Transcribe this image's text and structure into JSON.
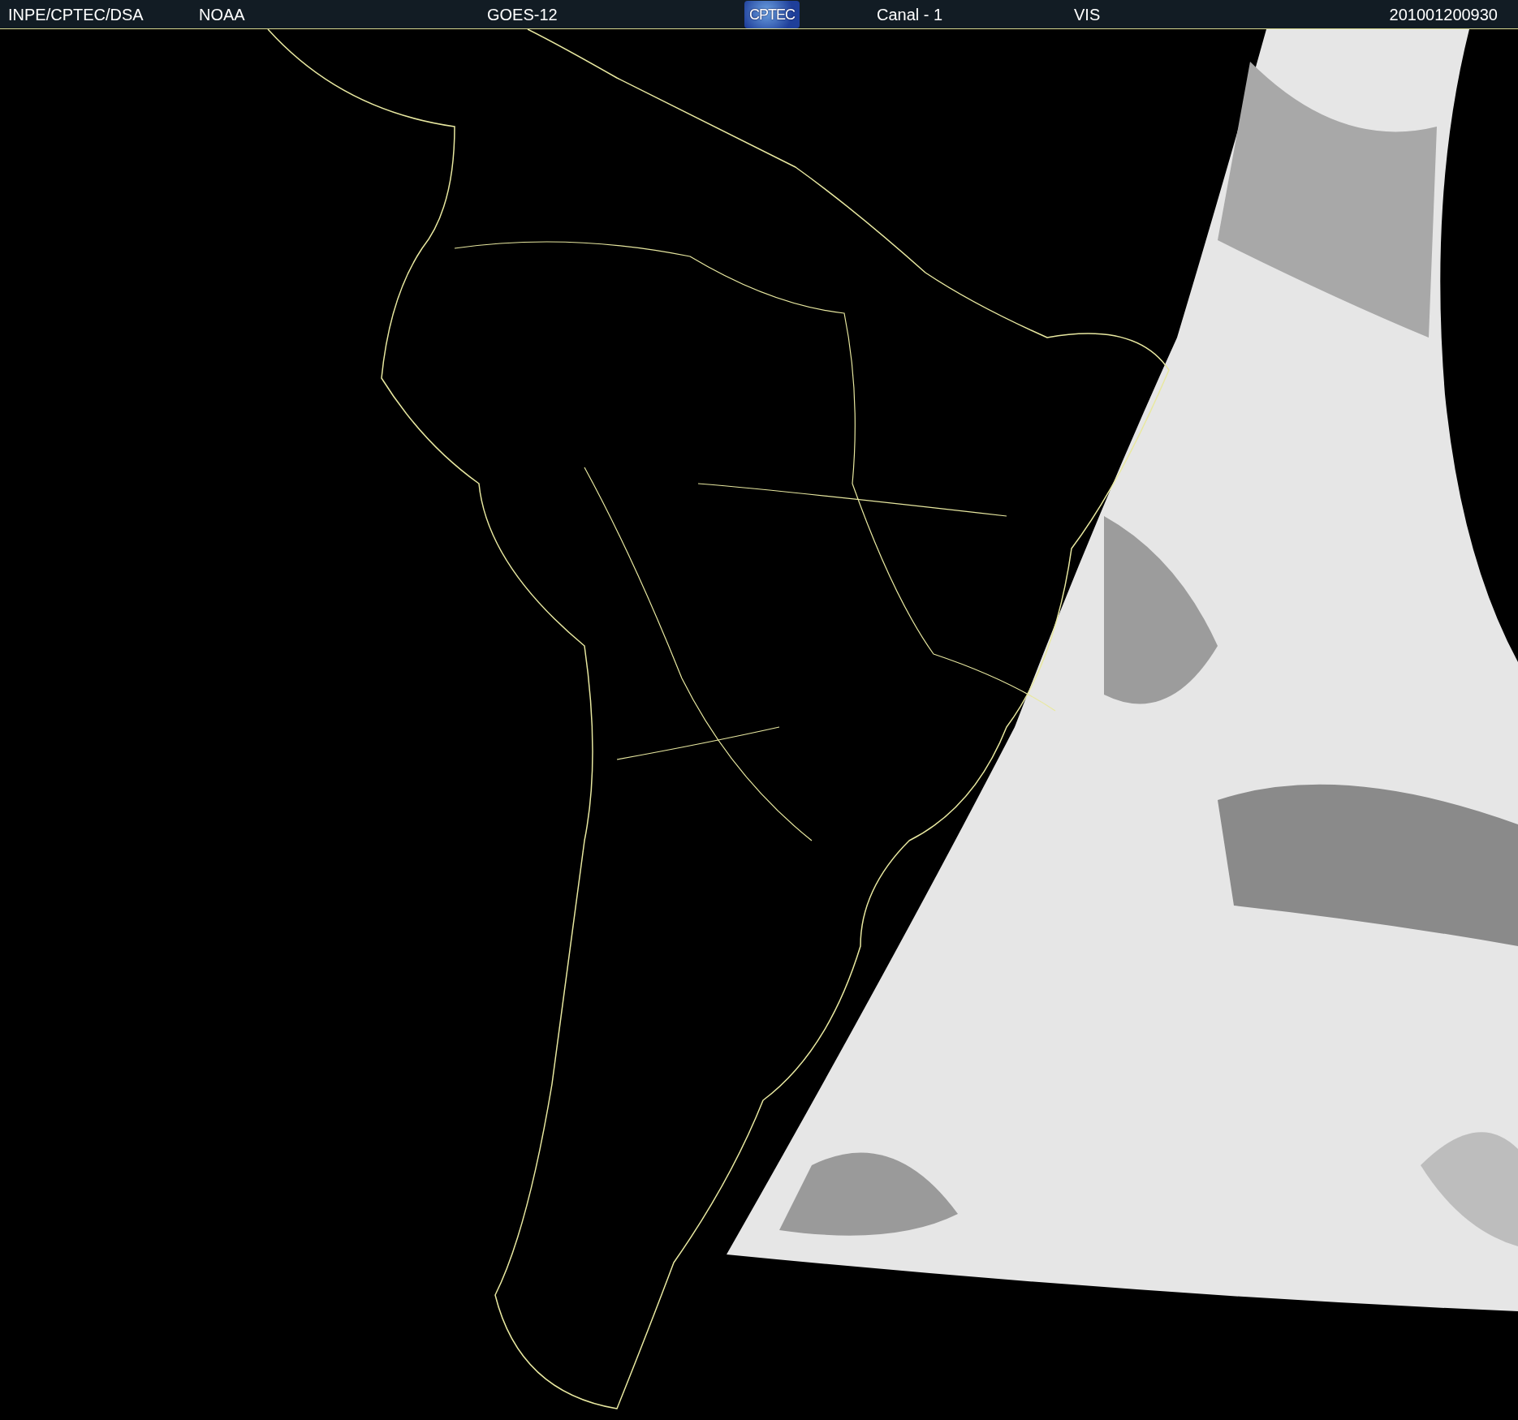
{
  "header": {
    "items": [
      {
        "kind": "text",
        "text": "INPE/CPTEC/DSA"
      },
      {
        "kind": "text",
        "text": "NOAA"
      },
      {
        "kind": "text",
        "text": "GOES-12"
      },
      {
        "kind": "logo",
        "text": "CPTEC"
      },
      {
        "kind": "text",
        "text": "Canal - 1"
      },
      {
        "kind": "text",
        "text": "VIS"
      },
      {
        "kind": "text",
        "text": "201001200930"
      }
    ]
  }
}
